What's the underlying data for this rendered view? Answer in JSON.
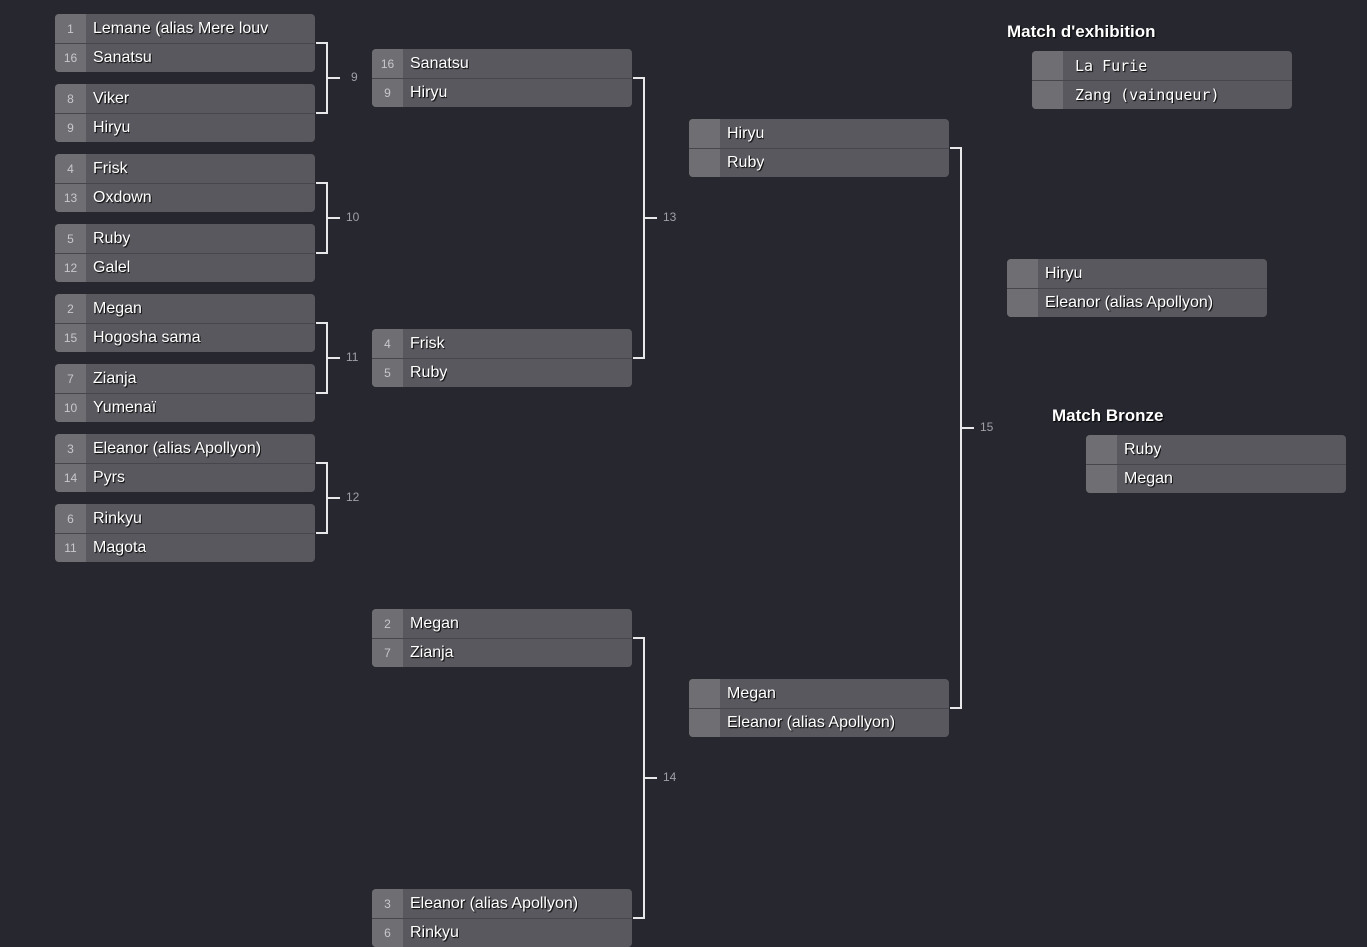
{
  "rounds": [
    [
      [
        {
          "seed": "1",
          "name": "Lemane (alias Mere louv"
        },
        {
          "seed": "16",
          "name": "Sanatsu"
        }
      ],
      [
        {
          "seed": "8",
          "name": "Viker"
        },
        {
          "seed": "9",
          "name": "Hiryu"
        }
      ],
      [
        {
          "seed": "4",
          "name": "Frisk"
        },
        {
          "seed": "13",
          "name": "Oxdown"
        }
      ],
      [
        {
          "seed": "5",
          "name": "Ruby"
        },
        {
          "seed": "12",
          "name": "Galel"
        }
      ],
      [
        {
          "seed": "2",
          "name": "Megan"
        },
        {
          "seed": "15",
          "name": "Hogosha sama"
        }
      ],
      [
        {
          "seed": "7",
          "name": "Zianja"
        },
        {
          "seed": "10",
          "name": "Yumenaï"
        }
      ],
      [
        {
          "seed": "3",
          "name": "Eleanor (alias Apollyon)"
        },
        {
          "seed": "14",
          "name": "Pyrs"
        }
      ],
      [
        {
          "seed": "6",
          "name": "Rinkyu"
        },
        {
          "seed": "11",
          "name": "Magota"
        }
      ]
    ],
    [
      [
        {
          "seed": "16",
          "name": "Sanatsu"
        },
        {
          "seed": "9",
          "name": "Hiryu"
        }
      ],
      [
        {
          "seed": "4",
          "name": "Frisk"
        },
        {
          "seed": "5",
          "name": "Ruby"
        }
      ],
      [
        {
          "seed": "2",
          "name": "Megan"
        },
        {
          "seed": "7",
          "name": "Zianja"
        }
      ],
      [
        {
          "seed": "3",
          "name": "Eleanor (alias Apollyon)"
        },
        {
          "seed": "6",
          "name": "Rinkyu"
        }
      ]
    ],
    [
      [
        {
          "seed": "",
          "name": "Hiryu"
        },
        {
          "seed": "",
          "name": "Ruby"
        }
      ],
      [
        {
          "seed": "",
          "name": "Megan"
        },
        {
          "seed": "",
          "name": "Eleanor (alias Apollyon)"
        }
      ]
    ],
    [
      [
        {
          "seed": "",
          "name": "Hiryu"
        },
        {
          "seed": "",
          "name": "Eleanor (alias Apollyon)"
        }
      ]
    ]
  ],
  "match_numbers": [
    [
      "9",
      "10",
      "11",
      "12"
    ],
    [
      "13",
      "14"
    ],
    [
      "15"
    ]
  ],
  "exhibition": {
    "title": "Match d'exhibition",
    "players": [
      {
        "seed": "",
        "name": "La Furie"
      },
      {
        "seed": "",
        "name": "Zang  (vainqueur)"
      }
    ]
  },
  "bronze": {
    "title": "Match Bronze",
    "players": [
      {
        "seed": "",
        "name": "Ruby"
      },
      {
        "seed": "",
        "name": "Megan"
      }
    ]
  }
}
